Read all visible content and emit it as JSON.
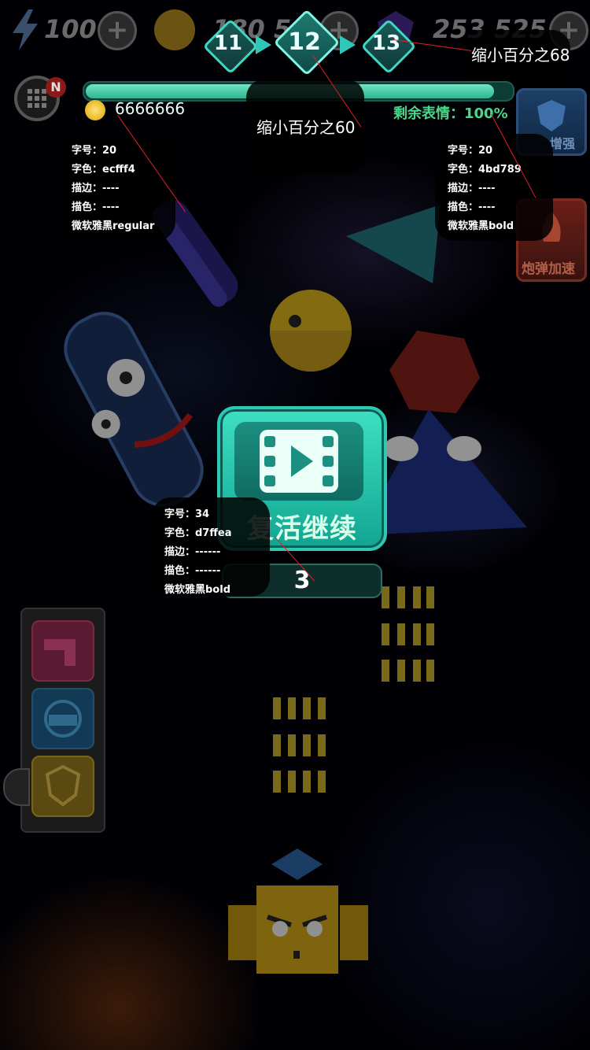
{
  "top_bar": {
    "energy_value": "100",
    "coin_value": "180 5",
    "gem_value": "253 525",
    "plus_symbol": "+"
  },
  "levels": {
    "prev": "11",
    "current": "12",
    "next": "13"
  },
  "annotations": {
    "level_note": "缩小百分之68",
    "progress_note": "缩小百分之60",
    "coin_spec": [
      "字号：20",
      "字色：ecfff4",
      "描边：----",
      "描色：----",
      "微软雅黑regular"
    ],
    "progress_spec": [
      "字号：20",
      "字色：4bd789",
      "描边：----",
      "描色：----",
      "微软雅黑bold"
    ],
    "revive_spec": [
      "字号：34",
      "字色：d7ffea",
      "描边：------",
      "描色：------",
      "微软雅黑bold"
    ]
  },
  "hud": {
    "coins": "6666666",
    "remaining_label": "剩余表情：",
    "remaining_percent": "100%",
    "progress_fraction": 0.96,
    "menu_badge": "N"
  },
  "side_right": {
    "enhance_label": "增强",
    "speed_label": "炮弹加速"
  },
  "revive": {
    "label": "复活继续",
    "countdown": "3"
  },
  "colors": {
    "accent": "#3fd6c4",
    "progress_text": "#4bd789",
    "revive_text": "#d7ffea",
    "coin_text": "#ecfff4"
  }
}
